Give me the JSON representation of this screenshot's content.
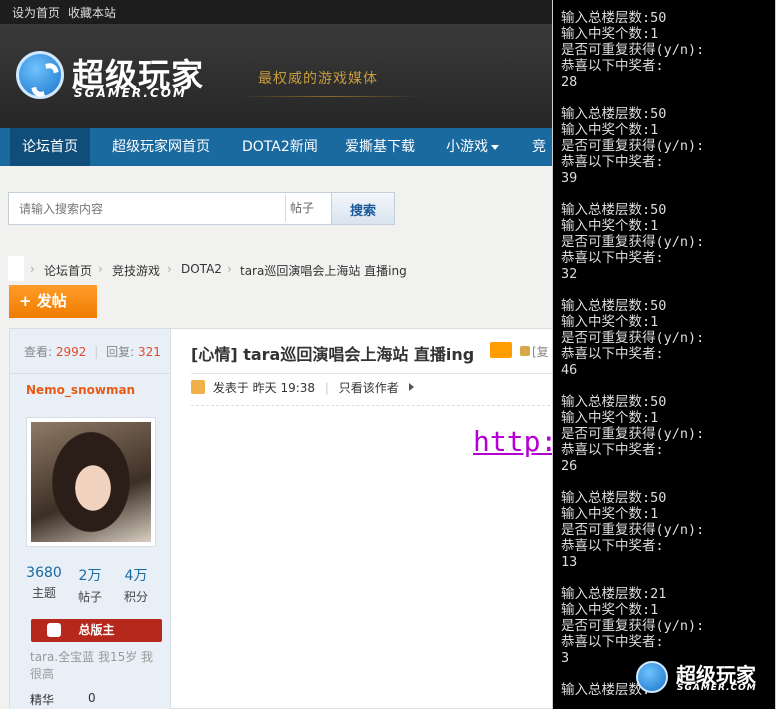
{
  "topbar": {
    "set_home": "设为首页",
    "bookmark": "收藏本站"
  },
  "header": {
    "logo_text": "超级玩家",
    "logo_sub": "SGAMER.COM",
    "slogan": "最权威的游戏媒体"
  },
  "nav": {
    "items": [
      {
        "label": "论坛首页"
      },
      {
        "label": "超级玩家网首页"
      },
      {
        "label": "DOTA2新闻"
      },
      {
        "label": "爱撕基下载"
      },
      {
        "label": "小游戏"
      },
      {
        "label": "竞"
      }
    ]
  },
  "search": {
    "placeholder": "请输入搜索内容",
    "type": "帖子",
    "button": "搜索"
  },
  "breadcrumb": [
    "论坛首页",
    "竞技游戏",
    "DOTA2",
    "tara巡回演唱会上海站 直播ing"
  ],
  "post_button": "+ 发帖",
  "thread": {
    "views_label": "查看:",
    "views": "2992",
    "replies_label": "回复:",
    "replies": "321",
    "username": "Nemo_snowman",
    "user_stats": [
      {
        "value": "3680",
        "label": "主题"
      },
      {
        "value": "2万",
        "label": "帖子"
      },
      {
        "value": "4万",
        "label": "积分"
      }
    ],
    "badge": "总版主",
    "signature": "tara.全宝蓝 我15岁 我很高",
    "jinghua_label": "精华",
    "jinghua_value": "0",
    "title": "[心情] tara巡回演唱会上海站 直播ing",
    "more_tag": "[复",
    "posted_prefix": "发表于",
    "posted_time": "昨天 19:38",
    "only_author": "只看该作者",
    "link_text": "http:/"
  },
  "console": {
    "lines": [
      "输入总楼层数:50",
      "输入中奖个数:1",
      "是否可重复获得(y/n):",
      "恭喜以下中奖者:",
      "28",
      "",
      "输入总楼层数:50",
      "输入中奖个数:1",
      "是否可重复获得(y/n):",
      "恭喜以下中奖者:",
      "39",
      "",
      "输入总楼层数:50",
      "输入中奖个数:1",
      "是否可重复获得(y/n):",
      "恭喜以下中奖者:",
      "32",
      "",
      "输入总楼层数:50",
      "输入中奖个数:1",
      "是否可重复获得(y/n):",
      "恭喜以下中奖者:",
      "46",
      "",
      "输入总楼层数:50",
      "输入中奖个数:1",
      "是否可重复获得(y/n):",
      "恭喜以下中奖者:",
      "26",
      "",
      "输入总楼层数:50",
      "输入中奖个数:1",
      "是否可重复获得(y/n):",
      "恭喜以下中奖者:",
      "13",
      "",
      "输入总楼层数:21",
      "输入中奖个数:1",
      "是否可重复获得(y/n):",
      "恭喜以下中奖者:",
      "3",
      "",
      "输入总楼层数:"
    ],
    "watermark": "超级玩家",
    "watermark_sub": "SGAMER.COM"
  }
}
